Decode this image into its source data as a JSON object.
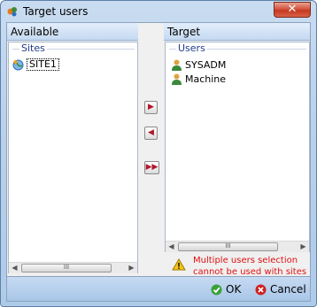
{
  "window": {
    "title": "Target users",
    "close_label": "✕"
  },
  "left_panel": {
    "header": "Available",
    "group_label": "Sites",
    "items": [
      {
        "label": "SITE1",
        "icon": "site-globe-icon",
        "selected": true
      }
    ],
    "scrollbar_thumb": "III"
  },
  "middle_buttons": [
    {
      "name": "move-right-button",
      "glyph": "▶"
    },
    {
      "name": "move-left-button",
      "glyph": "◀"
    },
    {
      "name": "move-all-right-button",
      "glyph": "▶▶"
    }
  ],
  "right_panel": {
    "header": "Target",
    "group_label": "Users",
    "items": [
      {
        "label": "SYSADM",
        "icon": "user-icon"
      },
      {
        "label": "Machine",
        "icon": "user-icon"
      }
    ],
    "scrollbar_thumb": "III",
    "warning": "Multiple users selection cannot be used with sites selected as users ..."
  },
  "buttons": {
    "ok": "OK",
    "cancel": "Cancel"
  },
  "colors": {
    "warning_text": "#e01010",
    "group_label": "#1f3b8a",
    "ok_icon": "#3aa03a",
    "cancel_icon": "#d02020"
  }
}
